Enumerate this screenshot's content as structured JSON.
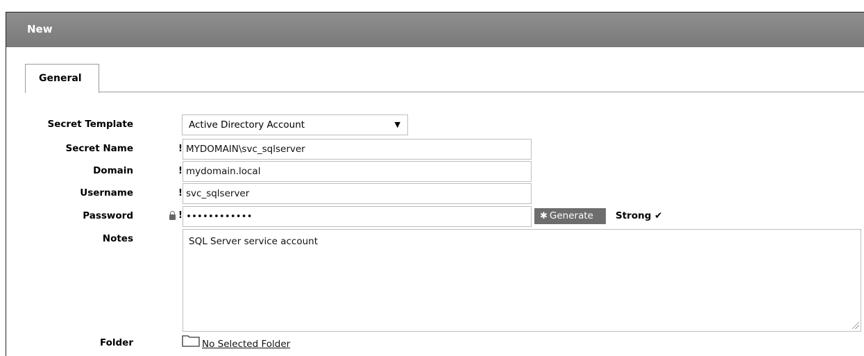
{
  "window": {
    "title": "New"
  },
  "tabs": [
    {
      "label": "General"
    }
  ],
  "form": {
    "secret_template": {
      "label": "Secret Template",
      "value": "Active Directory Account"
    },
    "secret_name": {
      "label": "Secret Name",
      "required_mark": "!",
      "value": "MYDOMAIN\\svc_sqlserver"
    },
    "domain": {
      "label": "Domain",
      "required_mark": "!",
      "value": "mydomain.local"
    },
    "username": {
      "label": "Username",
      "required_mark": "!",
      "value": "svc_sqlserver"
    },
    "password": {
      "label": "Password",
      "required_mark": "!",
      "value": "••••••••••••",
      "lock_icon": "lock-icon"
    },
    "generate_button": {
      "label": "Generate",
      "icon": "asterisk-icon"
    },
    "strength": {
      "label": "Strong",
      "icon": "checkmark-icon"
    },
    "notes": {
      "label": "Notes",
      "value": "SQL Server service account"
    },
    "folder": {
      "label": "Folder",
      "link": "No Selected Folder",
      "icon": "folder-icon"
    }
  },
  "colors": {
    "titlebar": "#808080",
    "button": "#6d6d6d"
  }
}
